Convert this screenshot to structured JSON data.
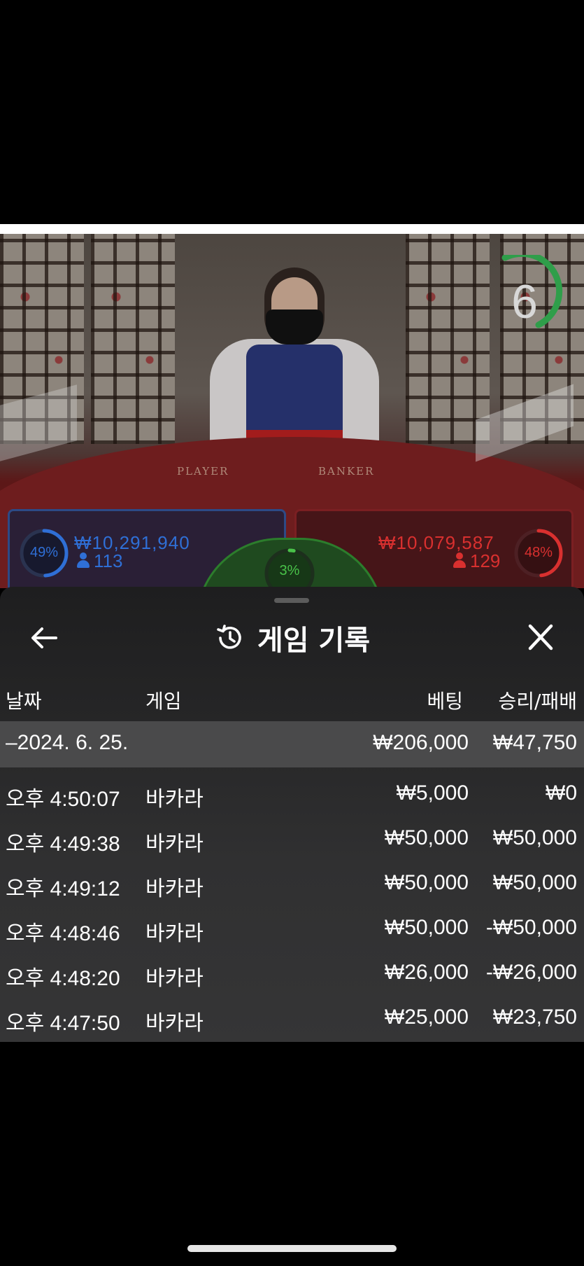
{
  "live_table": {
    "timer": "6",
    "table_label_player": "PLAYER",
    "table_label_banker": "BANKER",
    "player": {
      "percent_label": "49%",
      "percent": 49,
      "amount": "₩10,291,940",
      "count": "113",
      "color": "#2f6fd6"
    },
    "banker": {
      "percent_label": "48%",
      "percent": 48,
      "amount": "₩10,079,587",
      "count": "129",
      "color": "#d9302f"
    },
    "tie": {
      "percent_label": "3%",
      "percent": 3,
      "color": "#49c249"
    }
  },
  "sheet": {
    "title": "게임 기록",
    "back_icon": "arrow-left-icon",
    "history_icon": "history-icon",
    "close_icon": "close-icon",
    "columns": {
      "date": "날짜",
      "game": "게임",
      "bet": "베팅",
      "win_loss": "승리/패배"
    },
    "date_group": {
      "date": "–2024. 6. 25.",
      "bet_total": "₩206,000",
      "win_total": "₩47,750"
    },
    "rows": [
      {
        "time": "오후 4:50:07",
        "game": "바카라",
        "bet": "₩5,000",
        "result": "₩0"
      },
      {
        "time": "오후 4:49:38",
        "game": "바카라",
        "bet": "₩50,000",
        "result": "₩50,000"
      },
      {
        "time": "오후 4:49:12",
        "game": "바카라",
        "bet": "₩50,000",
        "result": "₩50,000"
      },
      {
        "time": "오후 4:48:46",
        "game": "바카라",
        "bet": "₩50,000",
        "result": "-₩50,000"
      },
      {
        "time": "오후 4:48:20",
        "game": "바카라",
        "bet": "₩26,000",
        "result": "-₩26,000"
      },
      {
        "time": "오후 4:47:50",
        "game": "바카라",
        "bet": "₩25,000",
        "result": "₩23,750"
      }
    ]
  }
}
